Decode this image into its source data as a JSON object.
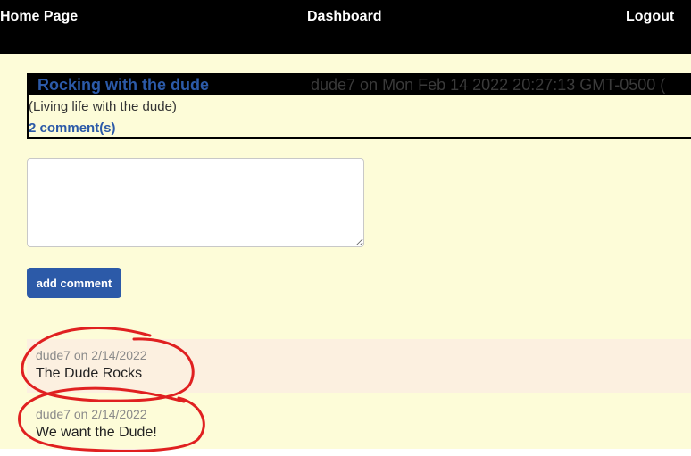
{
  "nav": {
    "home": "Home Page",
    "dashboard": "Dashboard",
    "logout": "Logout"
  },
  "post": {
    "title": "Rocking with the dude",
    "meta": "dude7 on Mon Feb 14 2022 20:27:13 GMT-0500 (",
    "body": "(Living life with the dude)",
    "comment_count": "2 comment(s)"
  },
  "comment_form": {
    "value": "",
    "button_label": "add comment"
  },
  "comments": [
    {
      "meta": "dude7 on 2/14/2022",
      "text": "The Dude Rocks"
    },
    {
      "meta": "dude7 on 2/14/2022",
      "text": "We want the Dude!"
    }
  ],
  "colors": {
    "background": "#fdfcd8",
    "nav_bg": "#000000",
    "accent": "#2c5aa8",
    "comment_highlight": "#fcf0e0",
    "annotation": "#e02020"
  }
}
